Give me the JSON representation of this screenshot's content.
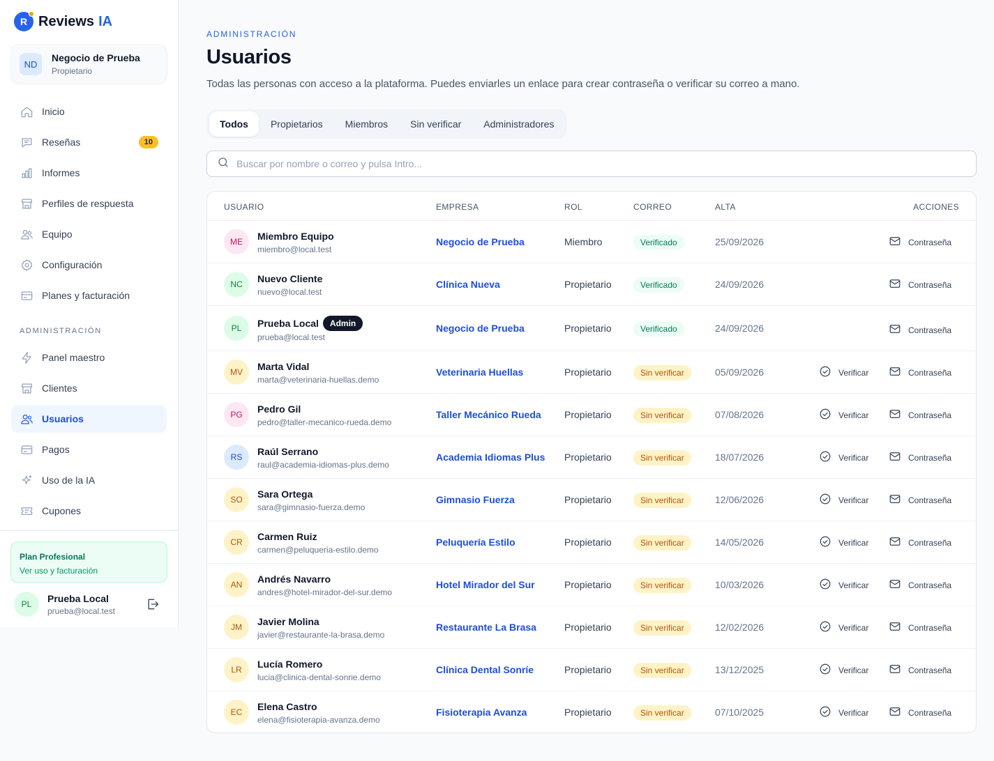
{
  "app": {
    "logo_letter": "R",
    "logo_text": "Reviews",
    "logo_accent": "IA"
  },
  "business": {
    "initials": "ND",
    "name": "Negocio de Prueba",
    "role": "Propietario"
  },
  "nav": {
    "items": [
      {
        "label": "Inicio",
        "icon": "home-icon"
      },
      {
        "label": "Reseñas",
        "icon": "chat-icon",
        "badge": "10"
      },
      {
        "label": "Informes",
        "icon": "bar-chart-icon"
      },
      {
        "label": "Perfiles de respuesta",
        "icon": "store-icon"
      },
      {
        "label": "Equipo",
        "icon": "users-icon"
      },
      {
        "label": "Configuración",
        "icon": "gear-icon"
      },
      {
        "label": "Planes y facturación",
        "icon": "credit-card-icon"
      }
    ],
    "admin_label": "ADMINISTRACIÓN",
    "admin_items": [
      {
        "label": "Panel maestro",
        "icon": "bolt-icon"
      },
      {
        "label": "Clientes",
        "icon": "store-icon"
      },
      {
        "label": "Usuarios",
        "icon": "users-icon",
        "active": true
      },
      {
        "label": "Pagos",
        "icon": "credit-card-icon"
      },
      {
        "label": "Uso de la IA",
        "icon": "sparkles-icon"
      },
      {
        "label": "Cupones",
        "icon": "ticket-icon"
      }
    ]
  },
  "plan": {
    "title": "Plan Profesional",
    "link": "Ver uso y facturación"
  },
  "current_user": {
    "initials": "PL",
    "name": "Prueba Local",
    "email": "prueba@local.test"
  },
  "page": {
    "eyebrow": "ADMINISTRACIÓN",
    "title": "Usuarios",
    "description": "Todas las personas con acceso a la plataforma. Puedes enviarles un enlace para crear contraseña o verificar su correo a mano."
  },
  "tabs": [
    "Todos",
    "Propietarios",
    "Miembros",
    "Sin verificar",
    "Administradores"
  ],
  "active_tab": "Todos",
  "search": {
    "placeholder": "Buscar por nombre o correo y pulsa Intro...",
    "value": ""
  },
  "table": {
    "headers": {
      "user": "USUARIO",
      "company": "EMPRESA",
      "role": "ROL",
      "email": "CORREO",
      "date": "ALTA",
      "actions": "ACCIONES"
    },
    "verify_label": "Verificar",
    "password_label": "Contraseña",
    "admin_badge": "Admin",
    "rows": [
      {
        "initials": "ME",
        "color": "pink",
        "name": "Miembro Equipo",
        "email": "miembro@local.test",
        "company": "Negocio de Prueba",
        "role": "Miembro",
        "status": "Verificado",
        "verified": true,
        "date": "25/09/2026"
      },
      {
        "initials": "NC",
        "color": "green",
        "name": "Nuevo Cliente",
        "email": "nuevo@local.test",
        "company": "Clínica Nueva",
        "role": "Propietario",
        "status": "Verificado",
        "verified": true,
        "date": "24/09/2026"
      },
      {
        "initials": "PL",
        "color": "green",
        "name": "Prueba Local",
        "email": "prueba@local.test",
        "company": "Negocio de Prueba",
        "role": "Propietario",
        "status": "Verificado",
        "verified": true,
        "date": "24/09/2026",
        "admin": true
      },
      {
        "initials": "MV",
        "color": "amber",
        "name": "Marta Vidal",
        "email": "marta@veterinaria-huellas.demo",
        "company": "Veterinaria Huellas",
        "role": "Propietario",
        "status": "Sin verificar",
        "verified": false,
        "date": "05/09/2026"
      },
      {
        "initials": "PG",
        "color": "pink",
        "name": "Pedro Gil",
        "email": "pedro@taller-mecanico-rueda.demo",
        "company": "Taller Mecánico Rueda",
        "role": "Propietario",
        "status": "Sin verificar",
        "verified": false,
        "date": "07/08/2026"
      },
      {
        "initials": "RS",
        "color": "blue",
        "name": "Raúl Serrano",
        "email": "raul@academia-idiomas-plus.demo",
        "company": "Academia Idiomas Plus",
        "role": "Propietario",
        "status": "Sin verificar",
        "verified": false,
        "date": "18/07/2026"
      },
      {
        "initials": "SO",
        "color": "amber",
        "name": "Sara Ortega",
        "email": "sara@gimnasio-fuerza.demo",
        "company": "Gimnasio Fuerza",
        "role": "Propietario",
        "status": "Sin verificar",
        "verified": false,
        "date": "12/06/2026"
      },
      {
        "initials": "CR",
        "color": "amber",
        "name": "Carmen Ruiz",
        "email": "carmen@peluqueria-estilo.demo",
        "company": "Peluquería Estilo",
        "role": "Propietario",
        "status": "Sin verificar",
        "verified": false,
        "date": "14/05/2026"
      },
      {
        "initials": "AN",
        "color": "amber",
        "name": "Andrés Navarro",
        "email": "andres@hotel-mirador-del-sur.demo",
        "company": "Hotel Mirador del Sur",
        "role": "Propietario",
        "status": "Sin verificar",
        "verified": false,
        "date": "10/03/2026"
      },
      {
        "initials": "JM",
        "color": "amber",
        "name": "Javier Molina",
        "email": "javier@restaurante-la-brasa.demo",
        "company": "Restaurante La Brasa",
        "role": "Propietario",
        "status": "Sin verificar",
        "verified": false,
        "date": "12/02/2026"
      },
      {
        "initials": "LR",
        "color": "amber",
        "name": "Lucía Romero",
        "email": "lucia@clinica-dental-sonrie.demo",
        "company": "Clínica Dental Sonríe",
        "role": "Propietario",
        "status": "Sin verificar",
        "verified": false,
        "date": "13/12/2025"
      },
      {
        "initials": "EC",
        "color": "amber",
        "name": "Elena Castro",
        "email": "elena@fisioterapia-avanza.demo",
        "company": "Fisioterapia Avanza",
        "role": "Propietario",
        "status": "Sin verificar",
        "verified": false,
        "date": "07/10/2025"
      }
    ]
  },
  "colors": {
    "accent": "#2563eb",
    "verified_bg": "#ecfdf5",
    "verified_text": "#047857",
    "unverified_bg": "#fef3c7",
    "unverified_text": "#b45309",
    "badge": "#fbbf24"
  }
}
